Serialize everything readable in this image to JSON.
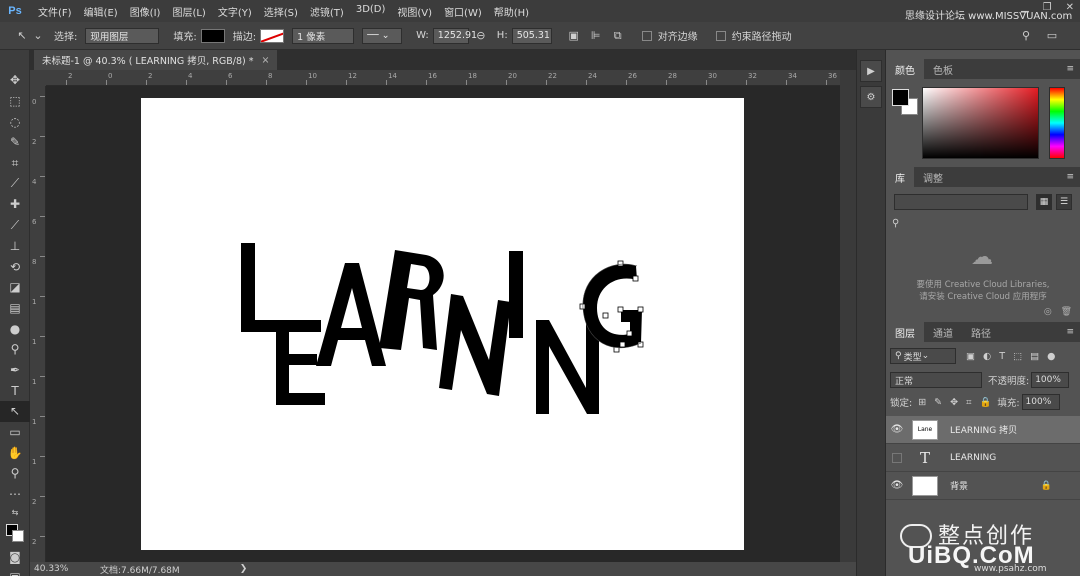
{
  "app": {
    "logo": "Ps"
  },
  "menu": [
    "文件(F)",
    "编辑(E)",
    "图像(I)",
    "图层(L)",
    "文字(Y)",
    "选择(S)",
    "滤镜(T)",
    "3D(D)",
    "视图(V)",
    "窗口(W)",
    "帮助(H)"
  ],
  "watermark_top": "思缘设计论坛 www.MISSVUAN.com",
  "options": {
    "select_label": "选择:",
    "select_value": "现用图层",
    "fill_label": "填充:",
    "stroke_label": "描边:",
    "stroke_width": "1 像素",
    "w_label": "W:",
    "w_value": "1252.91",
    "h_label": "H:",
    "h_value": "505.31",
    "align_edges": "对齐边缘",
    "constrain_path": "约束路径拖动"
  },
  "document": {
    "tab_title": "未标题-1 @ 40.3% ( LEARNING 拷贝, RGB/8) *",
    "close": "×"
  },
  "ruler_top": [
    "2",
    "0",
    "2",
    "4",
    "6",
    "8",
    "10",
    "12",
    "14",
    "16",
    "18",
    "20",
    "22",
    "24",
    "26",
    "28",
    "30",
    "32",
    "34",
    "36"
  ],
  "ruler_left": [
    "0",
    "2",
    "4",
    "6",
    "8",
    "1",
    "1",
    "1",
    "1",
    "1",
    "2",
    "2"
  ],
  "artwork": {
    "letters": [
      "L",
      "E",
      "A",
      "R",
      "N",
      "I",
      "N",
      "G"
    ]
  },
  "status": {
    "zoom": "40.33%",
    "doc": "文档:7.66M/7.68M",
    "arrow": "❯"
  },
  "colors": {
    "accent": "#e51c23",
    "panel_bg": "#535353",
    "canvas_bg": "#282828"
  },
  "panels": {
    "color_tabs": [
      "颜色",
      "色板"
    ],
    "library_tabs": [
      "库",
      "调整"
    ],
    "library_message_1": "要使用 Creative Cloud Libraries,",
    "library_message_2": "请安装 Creative Cloud 应用程序",
    "layers_tabs": [
      "图层",
      "通道",
      "路径"
    ],
    "filter_label": "类型",
    "blend_mode": "正常",
    "opacity_label": "不透明度:",
    "opacity_value": "100%",
    "lock_label": "锁定:",
    "fill_label": "填充:",
    "fill_value": "100%",
    "layers": [
      {
        "name": "LEARNING 拷贝",
        "visible": true,
        "selected": true,
        "thumb": "Lane"
      },
      {
        "name": "LEARNING",
        "visible": false,
        "selected": false,
        "thumb": "T"
      },
      {
        "name": "背景",
        "visible": true,
        "selected": false,
        "thumb": ""
      }
    ]
  },
  "bottom_watermark": {
    "title": "整点创作",
    "logo": "UiBQ.CoM",
    "url": "www.psahz.com"
  }
}
